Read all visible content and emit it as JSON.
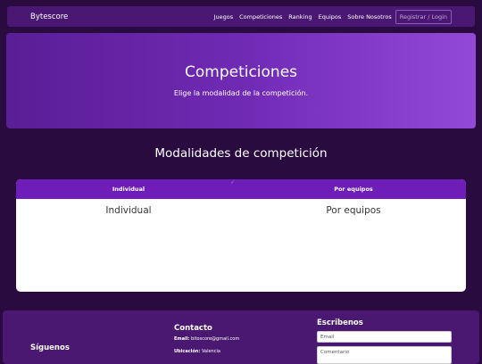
{
  "navbar": {
    "brand": "Bytescore",
    "links": [
      "Juegos",
      "Competiciones",
      "Ranking",
      "Equipos",
      "Sobre Nosotros"
    ],
    "login": "Registrar / Login"
  },
  "hero": {
    "title": "Competiciones",
    "subtitle": "Elige la modalidad de la competición."
  },
  "section": {
    "title": "Modalidades de competición"
  },
  "tabs": {
    "headers": [
      "Individual",
      "Por equipos"
    ],
    "contents": [
      "Individual",
      "Por equipos"
    ],
    "mark": "✓"
  },
  "footer": {
    "follow": "Síguenos",
    "contact_title": "Contacto",
    "email_label": "Email:",
    "email_value": "bitoscore@gmail.com",
    "location_label": "Ubicación:",
    "location_value": "Valencia",
    "write_title": "Escribenos",
    "email_placeholder": "Email",
    "comment_placeholder": "Comentario"
  },
  "colors": {
    "background": "#2a0b40",
    "navbar": "#4a1873",
    "tab_header": "#6e1db8",
    "hero_start": "#5a1e95",
    "hero_end": "#9349d8"
  }
}
